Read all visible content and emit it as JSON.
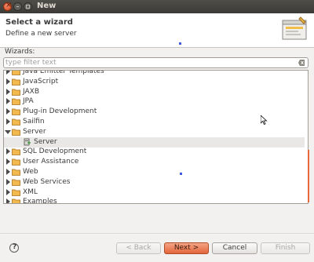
{
  "window": {
    "title": "New"
  },
  "header": {
    "title": "Select a wizard",
    "description": "Define a new server"
  },
  "wizards_label": "Wizards:",
  "filter": {
    "placeholder": "type filter text",
    "value": ""
  },
  "tree": {
    "items": [
      {
        "label": "Java Emitter Templates",
        "expanded": false,
        "level": 0,
        "partial": true
      },
      {
        "label": "JavaScript",
        "expanded": false,
        "level": 0
      },
      {
        "label": "JAXB",
        "expanded": false,
        "level": 0
      },
      {
        "label": "JPA",
        "expanded": false,
        "level": 0
      },
      {
        "label": "Plug-in Development",
        "expanded": false,
        "level": 0
      },
      {
        "label": "Sailfin",
        "expanded": false,
        "level": 0
      },
      {
        "label": "Server",
        "expanded": true,
        "level": 0
      },
      {
        "label": "Server",
        "level": 1,
        "selected": true
      },
      {
        "label": "SQL Development",
        "expanded": false,
        "level": 0
      },
      {
        "label": "User Assistance",
        "expanded": false,
        "level": 0
      },
      {
        "label": "Web",
        "expanded": false,
        "level": 0
      },
      {
        "label": "Web Services",
        "expanded": false,
        "level": 0
      },
      {
        "label": "XML",
        "expanded": false,
        "level": 0
      },
      {
        "label": "Examples",
        "expanded": false,
        "level": 0,
        "partial": true
      }
    ]
  },
  "buttons": {
    "back": "< Back",
    "next": "Next >",
    "cancel": "Cancel",
    "finish": "Finish"
  },
  "colors": {
    "accent": "#e3653a",
    "folder": "#e8a33d",
    "selection": "#e9e8e6"
  }
}
